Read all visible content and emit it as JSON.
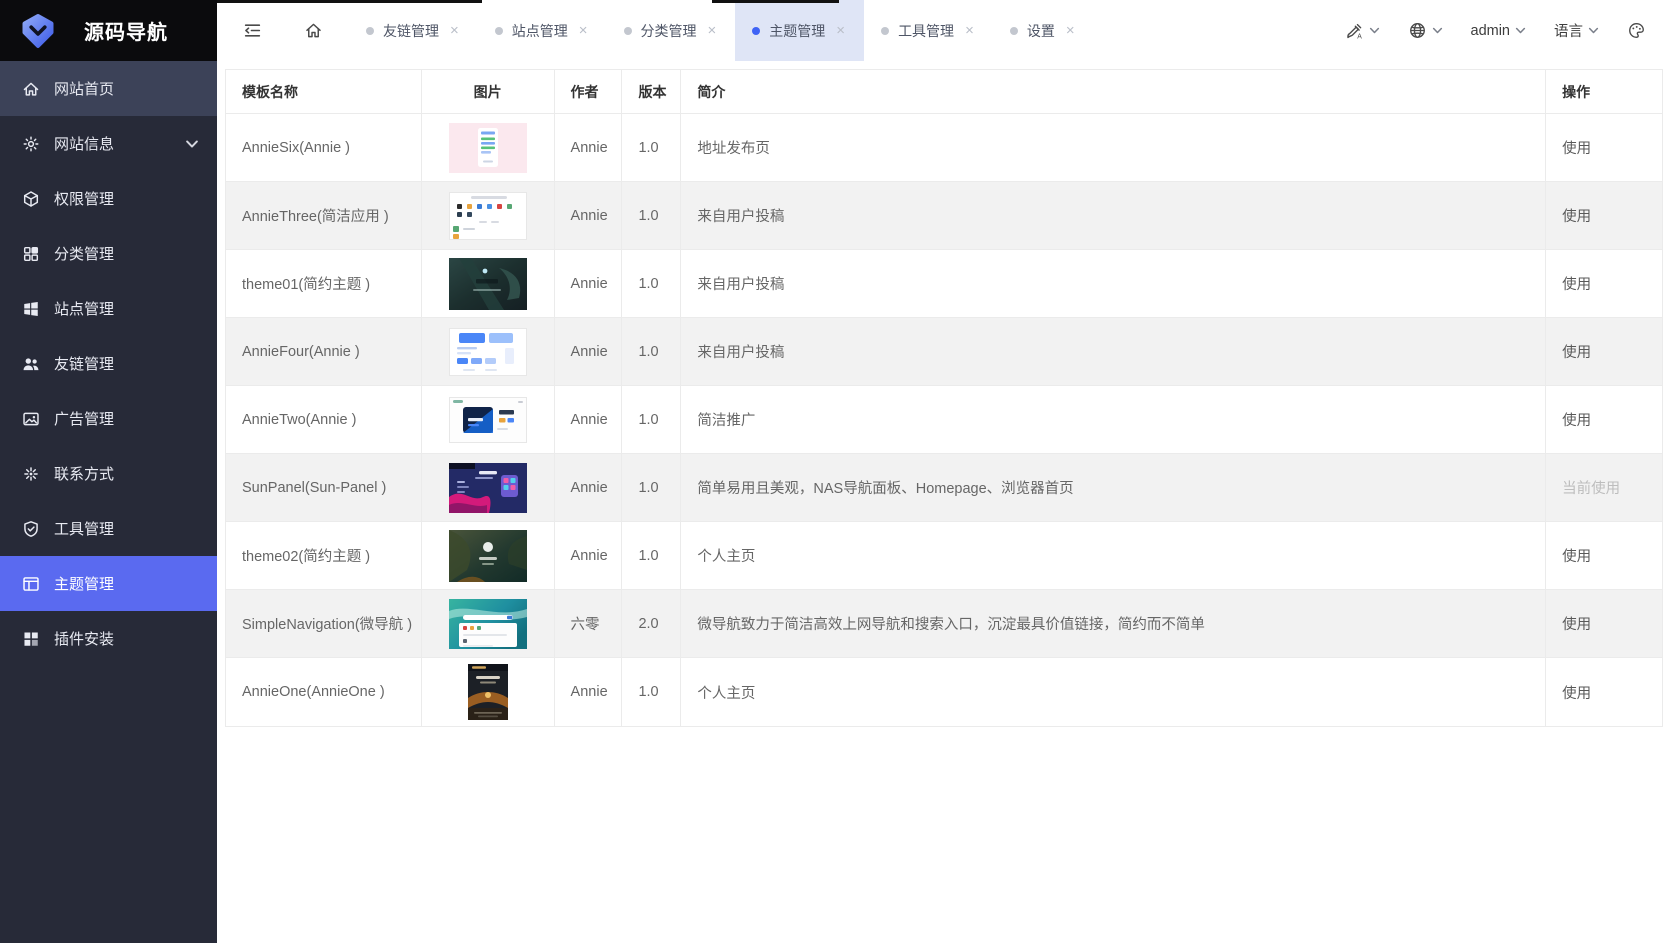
{
  "brand": {
    "title": "源码导航",
    "logo_icon": "gem-chevron-logo"
  },
  "sidebar": {
    "submenu_icon": "chevron-down-icon",
    "items": [
      {
        "label": "网站首页",
        "icon": "home-icon",
        "state": "highlight",
        "has_submenu": false
      },
      {
        "label": "网站信息",
        "icon": "gear-icon",
        "state": "normal",
        "has_submenu": true
      },
      {
        "label": "权限管理",
        "icon": "cube-icon",
        "state": "normal",
        "has_submenu": false
      },
      {
        "label": "分类管理",
        "icon": "category-grid-icon",
        "state": "normal",
        "has_submenu": false
      },
      {
        "label": "站点管理",
        "icon": "site-windows-icon",
        "state": "normal",
        "has_submenu": false
      },
      {
        "label": "友链管理",
        "icon": "users-icon",
        "state": "normal",
        "has_submenu": false
      },
      {
        "label": "广告管理",
        "icon": "image-icon",
        "state": "normal",
        "has_submenu": false
      },
      {
        "label": "联系方式",
        "icon": "contact-spark-icon",
        "state": "normal",
        "has_submenu": false
      },
      {
        "label": "工具管理",
        "icon": "shield-check-icon",
        "state": "normal",
        "has_submenu": false
      },
      {
        "label": "主题管理",
        "icon": "theme-layout-icon",
        "state": "active",
        "has_submenu": false
      },
      {
        "label": "插件安装",
        "icon": "plugin-grid-icon",
        "state": "normal",
        "has_submenu": false
      }
    ]
  },
  "topbar": {
    "collapse_icon": "menu-fold-icon",
    "home_icon": "home-outline-icon",
    "close_glyph": "×",
    "tabs": [
      {
        "label": "友链管理",
        "active": false
      },
      {
        "label": "站点管理",
        "active": false
      },
      {
        "label": "分类管理",
        "active": false
      },
      {
        "label": "主题管理",
        "active": true
      },
      {
        "label": "工具管理",
        "active": false
      },
      {
        "label": "设置",
        "active": false
      }
    ],
    "right": {
      "translate_icon": "brush-translate-icon",
      "globe_icon": "globe-icon",
      "palette_icon": "palette-icon",
      "chevron_icon": "chevron-down-icon",
      "username": "admin",
      "language_label": "语言"
    }
  },
  "table": {
    "columns": [
      "模板名称",
      "图片",
      "作者",
      "版本",
      "简介",
      "操作"
    ],
    "rows": [
      {
        "name": "AnnieSix(Annie )",
        "thumb": "anniesix",
        "author": "Annie",
        "version": "1.0",
        "description": "地址发布页",
        "action": "使用",
        "current": false
      },
      {
        "name": "AnnieThree(简洁应用 )",
        "thumb": "anniethree",
        "author": "Annie",
        "version": "1.0",
        "description": "来自用户投稿",
        "action": "使用",
        "current": false
      },
      {
        "name": "theme01(简约主题 )",
        "thumb": "theme01",
        "author": "Annie",
        "version": "1.0",
        "description": "来自用户投稿",
        "action": "使用",
        "current": false
      },
      {
        "name": "AnnieFour(Annie )",
        "thumb": "anniefour",
        "author": "Annie",
        "version": "1.0",
        "description": "来自用户投稿",
        "action": "使用",
        "current": false
      },
      {
        "name": "AnnieTwo(Annie )",
        "thumb": "annietwo",
        "author": "Annie",
        "version": "1.0",
        "description": "简洁推广",
        "action": "使用",
        "current": false
      },
      {
        "name": "SunPanel(Sun-Panel )",
        "thumb": "sunpanel",
        "author": "Annie",
        "version": "1.0",
        "description": "简单易用且美观，NAS导航面板、Homepage、浏览器首页",
        "action": "当前使用",
        "current": true
      },
      {
        "name": "theme02(简约主题 )",
        "thumb": "theme02",
        "author": "Annie",
        "version": "1.0",
        "description": "个人主页",
        "action": "使用",
        "current": false
      },
      {
        "name": "SimpleNavigation(微导航 )",
        "thumb": "simplenav",
        "author": "六零",
        "version": "2.0",
        "description": "微导航致力于简洁高效上网导航和搜索入口，沉淀最具价值链接，简约而不简单",
        "action": "使用",
        "current": false
      },
      {
        "name": "AnnieOne(AnnieOne )",
        "thumb": "annieone",
        "author": "Annie",
        "version": "1.0",
        "description": "个人主页",
        "action": "使用",
        "current": false
      }
    ]
  },
  "colors": {
    "accent": "#5a6af0",
    "sidebar_bg": "#272a38",
    "sidebar_highlight_bg": "#3c4258",
    "logo_bar_bg": "#0b0b0d",
    "active_tab_bg": "#dfe5f6",
    "active_tab_dot": "#3f63f5",
    "inactive_tab_dot": "#c3c7cf",
    "row_stripe": "#f2f2f2",
    "table_border": "#ebebeb",
    "current_use_text": "#bdbdbd"
  }
}
